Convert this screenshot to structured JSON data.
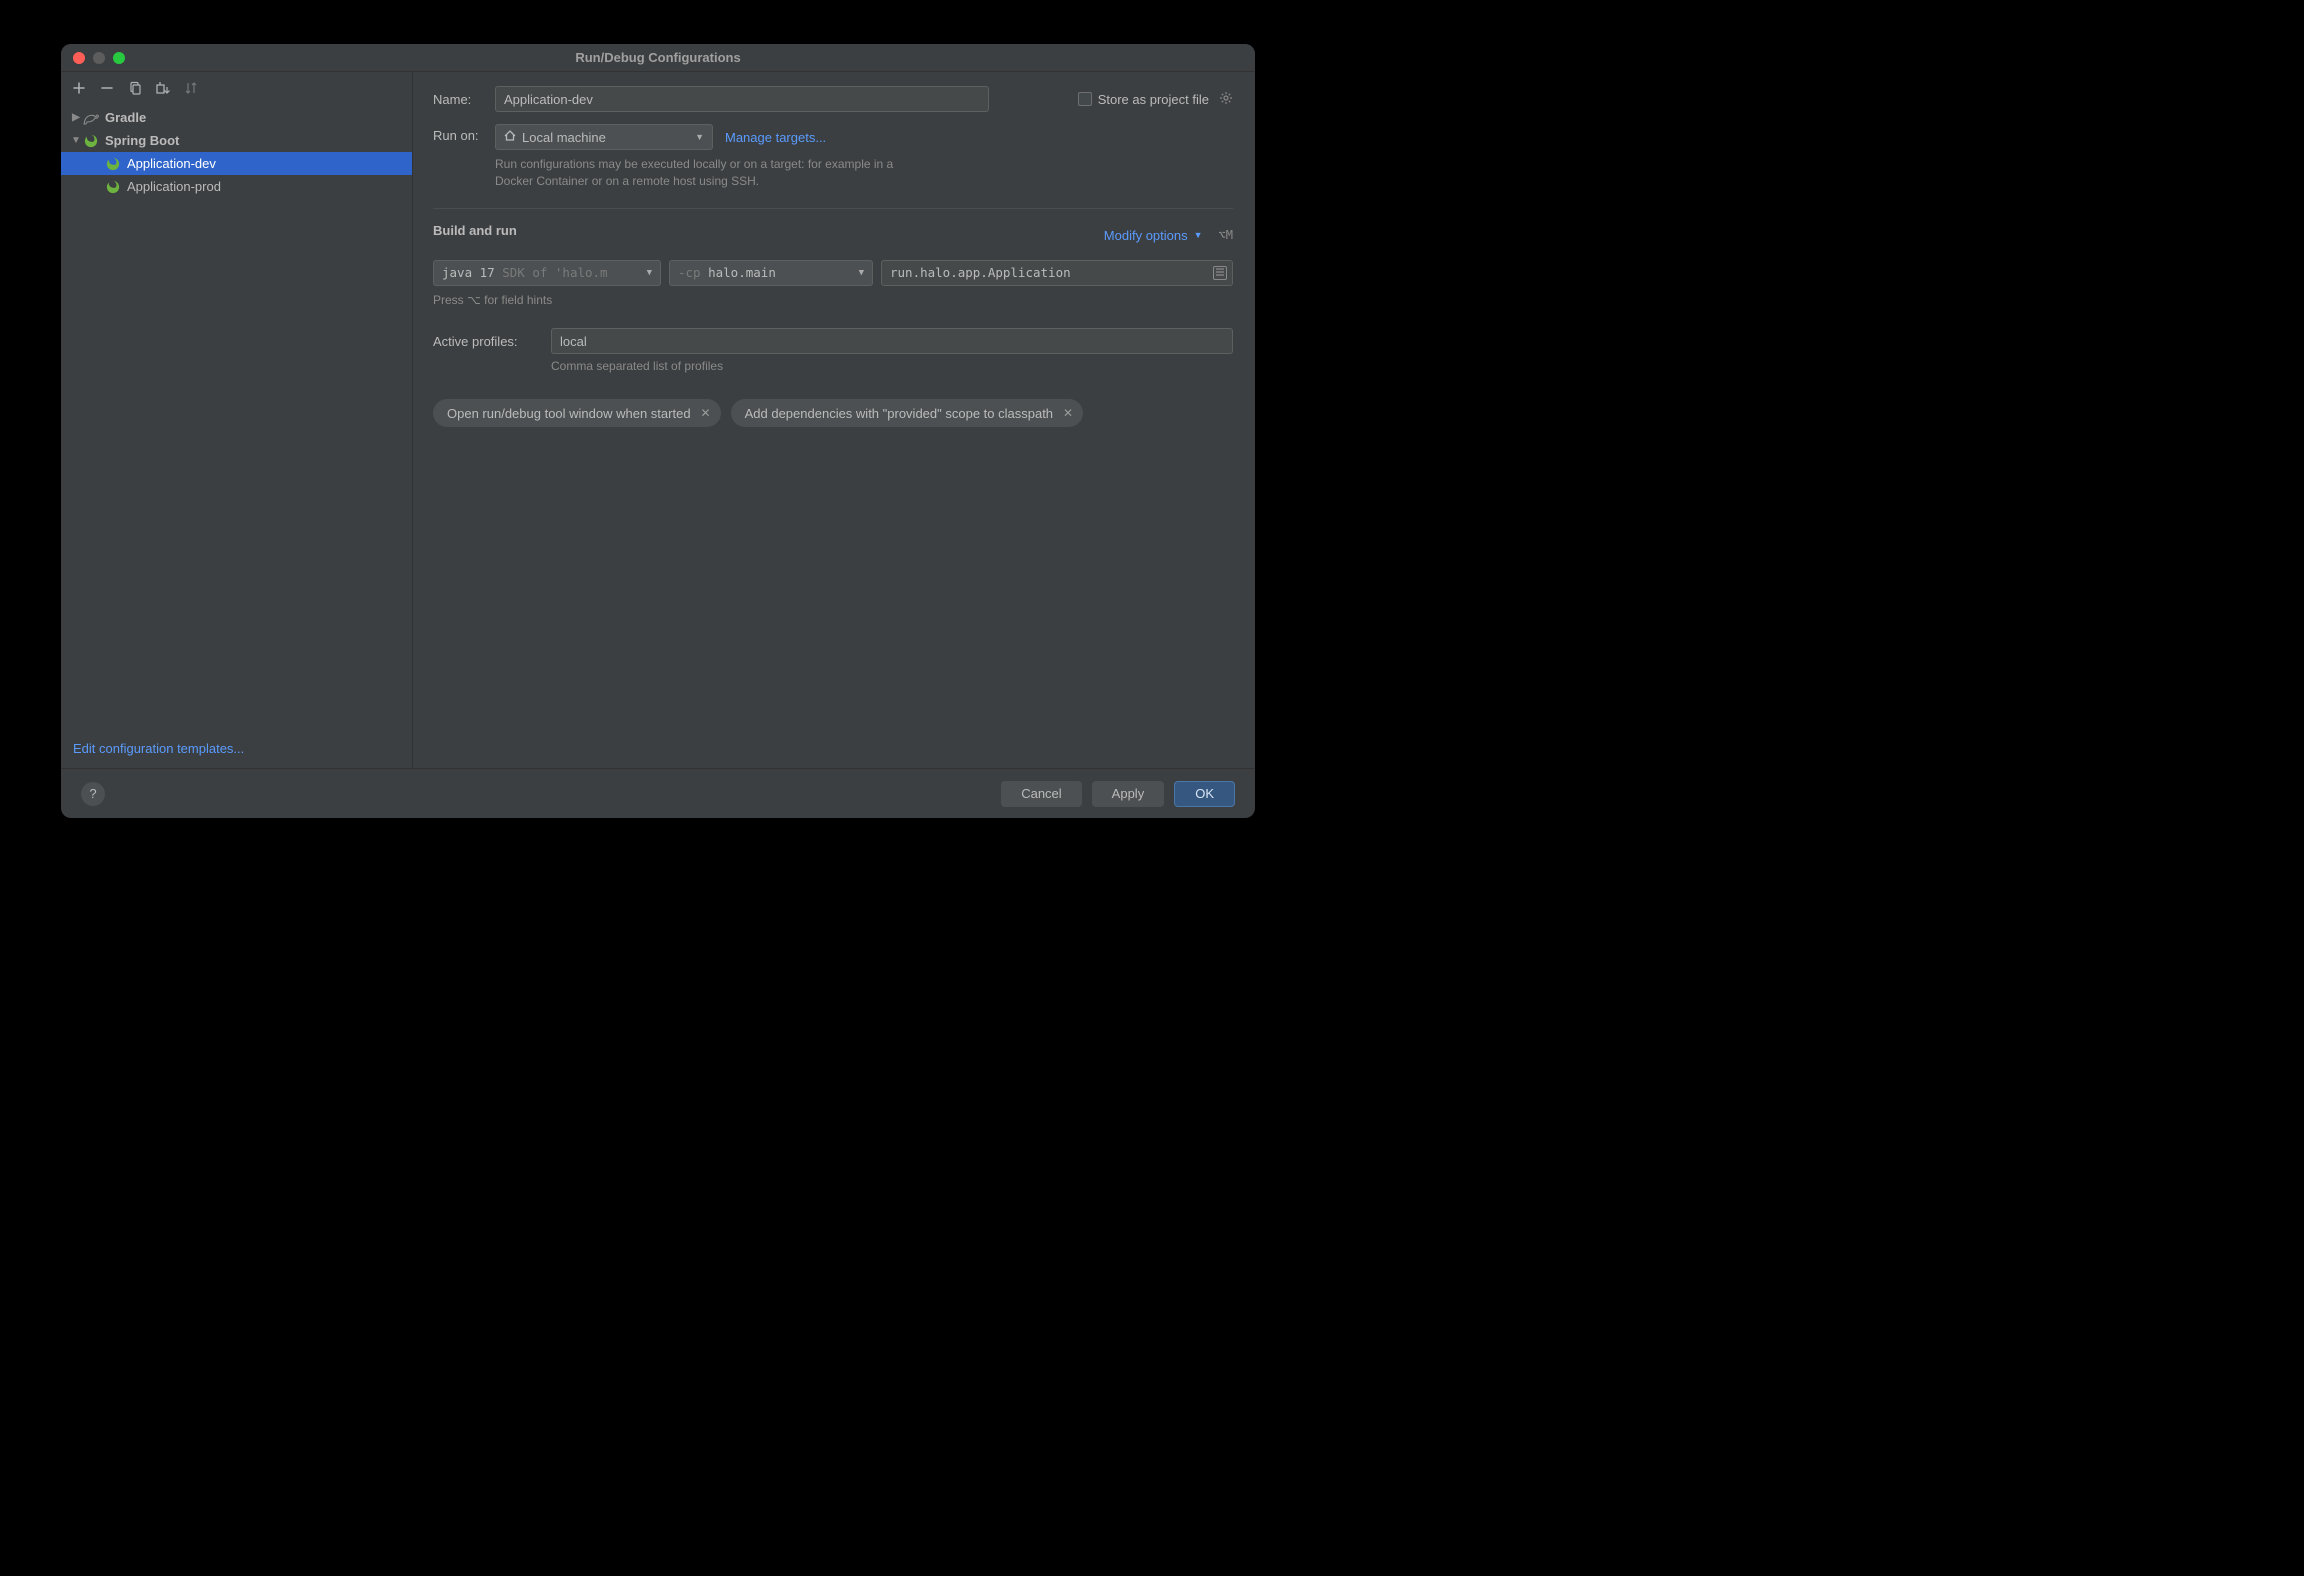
{
  "window": {
    "title": "Run/Debug Configurations"
  },
  "toolbar": {
    "add": "+",
    "remove": "−"
  },
  "tree": {
    "gradle": "Gradle",
    "spring_boot": "Spring Boot",
    "app_dev": "Application-dev",
    "app_prod": "Application-prod"
  },
  "sidebar_footer": {
    "edit_templates": "Edit configuration templates..."
  },
  "form": {
    "name_label": "Name:",
    "name_value": "Application-dev",
    "store_as_file": "Store as project file",
    "run_on_label": "Run on:",
    "run_on_value": "Local machine",
    "manage_targets": "Manage targets...",
    "run_on_hint": "Run configurations may be executed locally or on a target: for example in a Docker Container or on a remote host using SSH.",
    "build_run_title": "Build and run",
    "modify_options": "Modify options",
    "modify_shortcut": "⌥M",
    "jdk_display_prefix": "java 17 ",
    "jdk_display_suffix": "SDK of 'halo.m",
    "cp_prefix": "-cp ",
    "cp_value": "halo.main",
    "main_class": "run.halo.app.Application",
    "press_hint": "Press ⌥ for field hints",
    "active_profiles_label": "Active profiles:",
    "active_profiles_value": "local",
    "profiles_hint": "Comma separated list of profiles",
    "chip1": "Open run/debug tool window when started",
    "chip2": "Add dependencies with \"provided\" scope to classpath"
  },
  "footer": {
    "cancel": "Cancel",
    "apply": "Apply",
    "ok": "OK"
  }
}
